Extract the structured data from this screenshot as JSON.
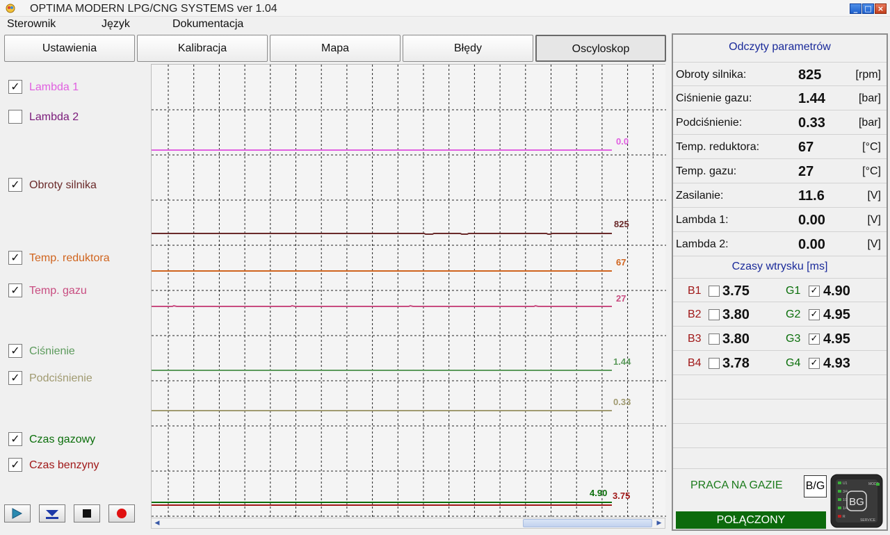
{
  "window": {
    "title": "OPTIMA MODERN LPG/CNG SYSTEMS ver 1.04"
  },
  "menu": [
    "Sterownik",
    "Język",
    "Dokumentacja"
  ],
  "tabs": [
    {
      "label": "Ustawienia",
      "active": false
    },
    {
      "label": "Kalibracja",
      "active": false
    },
    {
      "label": "Mapa",
      "active": false
    },
    {
      "label": "Błędy",
      "active": false
    },
    {
      "label": "Oscyloskop",
      "active": true
    }
  ],
  "legend": [
    {
      "label": "Lambda 1",
      "checked": true,
      "color": "#e060e0"
    },
    {
      "label": "Lambda 2",
      "checked": false,
      "color": "#7a1a7a"
    },
    {
      "label": "Obroty silnika",
      "checked": true,
      "color": "#6a2a2a"
    },
    {
      "label": "Temp. reduktora",
      "checked": true,
      "color": "#d0641e"
    },
    {
      "label": "Temp. gazu",
      "checked": true,
      "color": "#c84c80"
    },
    {
      "label": "Ciśnienie",
      "checked": true,
      "color": "#5c9a5c"
    },
    {
      "label": "Podciśnienie",
      "checked": true,
      "color": "#a09a70"
    },
    {
      "label": "Czas gazowy",
      "checked": true,
      "color": "#0a6e0a"
    },
    {
      "label": "Czas benzyny",
      "checked": true,
      "color": "#a01818"
    }
  ],
  "controls": [
    "play",
    "download",
    "stop",
    "record"
  ],
  "scope": {
    "traces": [
      {
        "name": "Lambda 1",
        "label": "0.0",
        "color": "#e060e0"
      },
      {
        "name": "Obroty silnika",
        "label": "825",
        "color": "#6a2a2a"
      },
      {
        "name": "Temp. reduktora",
        "label": "67",
        "color": "#d0641e"
      },
      {
        "name": "Temp. gazu",
        "label": "27",
        "color": "#c84c80"
      },
      {
        "name": "Ciśnienie",
        "label": "1.44",
        "color": "#5c9a5c"
      },
      {
        "name": "Podciśnienie",
        "label": "0.33",
        "color": "#a09a70"
      },
      {
        "name": "Czas gazowy",
        "label": "4.90",
        "color": "#0a6e0a"
      },
      {
        "name": "Czas benzyny",
        "label": "3.75",
        "color": "#a01818"
      }
    ]
  },
  "right_panel": {
    "params_title": "Odczyty parametrów",
    "params": [
      {
        "label": "Obroty silnika:",
        "value": "825",
        "unit": "[rpm]"
      },
      {
        "label": "Ciśnienie gazu:",
        "value": "1.44",
        "unit": "[bar]"
      },
      {
        "label": "Podciśnienie:",
        "value": "0.33",
        "unit": "[bar]"
      },
      {
        "label": "Temp. reduktora:",
        "value": "67",
        "unit": "[°C]"
      },
      {
        "label": "Temp. gazu:",
        "value": "27",
        "unit": "[°C]"
      },
      {
        "label": "Zasilanie:",
        "value": "11.6",
        "unit": "[V]"
      },
      {
        "label": "Lambda 1:",
        "value": "0.00",
        "unit": "[V]"
      },
      {
        "label": "Lambda 2:",
        "value": "0.00",
        "unit": "[V]"
      }
    ],
    "injection_title": "Czasy wtrysku [ms]",
    "injection": [
      {
        "b_name": "B1",
        "b_checked": false,
        "b_value": "3.75",
        "g_name": "G1",
        "g_checked": true,
        "g_value": "4.90"
      },
      {
        "b_name": "B2",
        "b_checked": false,
        "b_value": "3.80",
        "g_name": "G2",
        "g_checked": true,
        "g_value": "4.95"
      },
      {
        "b_name": "B3",
        "b_checked": false,
        "b_value": "3.80",
        "g_name": "G3",
        "g_checked": true,
        "g_value": "4.95"
      },
      {
        "b_name": "B4",
        "b_checked": false,
        "b_value": "3.78",
        "g_name": "G4",
        "g_checked": true,
        "g_value": "4.93"
      }
    ],
    "status": "PRACA NA GAZIE",
    "switch_label": "B/G",
    "connection": "POŁĄCZONY",
    "device": {
      "left_leds": [
        "U1",
        "3/4",
        "1/2",
        "1/4",
        "R"
      ],
      "right_labels": [
        "MODE",
        "SERVICE"
      ],
      "logo": "BG"
    }
  }
}
